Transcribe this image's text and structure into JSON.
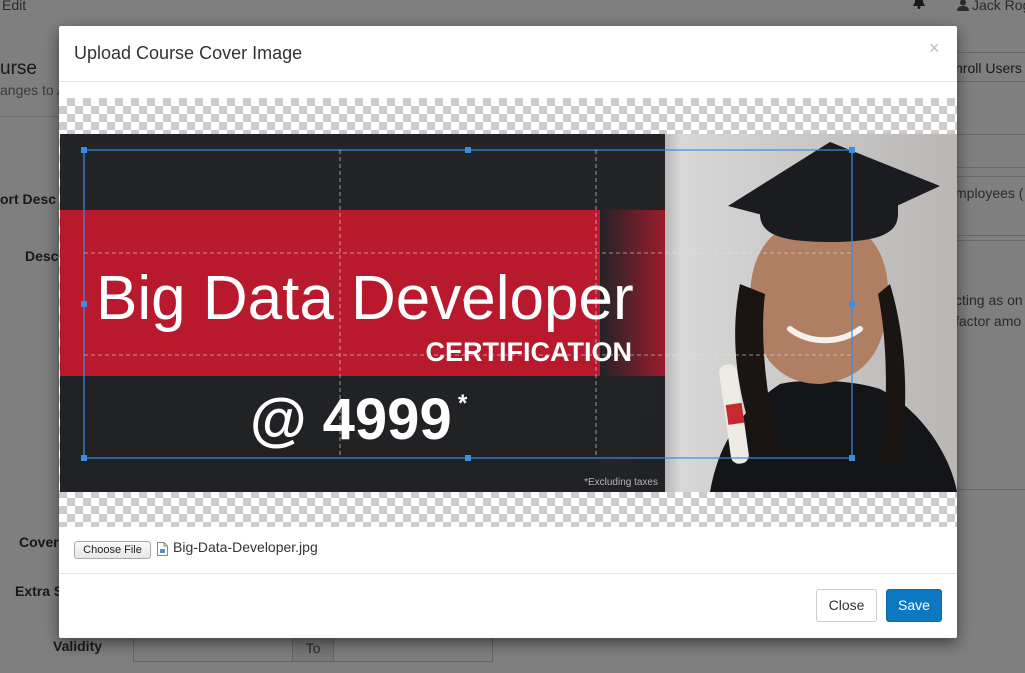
{
  "background": {
    "nav_edit": "Edit",
    "user_name": "Jack Rog",
    "page_title": "urse",
    "page_subtitle": "anges to A",
    "enroll_button": "nroll Users",
    "labels": {
      "short_desc": "ort Desc",
      "desc": "Desc",
      "cover": "Cover",
      "extra": "Extra S",
      "validity": "Validity"
    },
    "right_text_1": "mployees (",
    "right_text_2": "cting as on",
    "right_text_3": "factor amo",
    "validity_to": "To"
  },
  "modal": {
    "title": "Upload Course Cover Image",
    "close_symbol": "×",
    "banner": {
      "headline": "Big Data Developer",
      "sub": "CERTIFICATION",
      "price": "@ 4999",
      "price_mark": "*",
      "footnote": "*Excluding taxes"
    },
    "file": {
      "choose_label": "Choose File",
      "filename": "Big-Data-Developer.jpg"
    },
    "footer": {
      "close_label": "Close",
      "save_label": "Save"
    }
  },
  "colors": {
    "primary": "#0d78c2",
    "banner_red": "#b8192c",
    "banner_dark": "#222427",
    "crop_selection": "#3a8de0"
  }
}
